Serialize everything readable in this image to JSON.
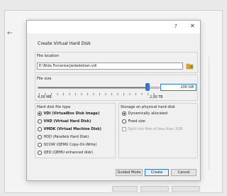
{
  "background": {
    "back_icon": "back-arrow-icon"
  },
  "dialog": {
    "help_glyph": "?",
    "close_glyph": "✕",
    "heading": "Create Virtual Hard Disk",
    "file_location": {
      "label": "File location",
      "value": "E:\\Nida Fovianka\\jwdadebian.vdi",
      "icon": "folder-browse-icon"
    },
    "file_size": {
      "label": "File size",
      "value": "200 GB",
      "min_label": "4,00 MB",
      "max_label": "2,00 TB",
      "slider_fraction": 0.9
    },
    "disk_type": {
      "label": "Hard disk file type",
      "options": [
        {
          "label": "VDI (VirtualBox Disk Image)",
          "selected": true,
          "bold": true
        },
        {
          "label": "VHD (Virtual Hard Disk)",
          "selected": false,
          "bold": true
        },
        {
          "label": "VMDK (Virtual Machine Disk)",
          "selected": false,
          "bold": true
        },
        {
          "label": "HDD (Parallels Hard Disk)",
          "selected": false,
          "bold": false
        },
        {
          "label": "QCOW (QEMU Copy-On-Write)",
          "selected": false,
          "bold": false
        },
        {
          "label": "QED (QEMU enhanced disk)",
          "selected": false,
          "bold": false
        }
      ]
    },
    "storage": {
      "label": "Storage on physical hard disk",
      "dynamic": "Dynamically allocated",
      "fixed": "Fixed size",
      "split": "Split into files of less than 2GB"
    },
    "buttons": {
      "guided": "Guided Mode",
      "create": "Create",
      "cancel": "Cancel"
    }
  },
  "colors": {
    "accent": "#2f78d6",
    "folder": "#e3a21a",
    "folder_accent": "#3a9a3a"
  }
}
